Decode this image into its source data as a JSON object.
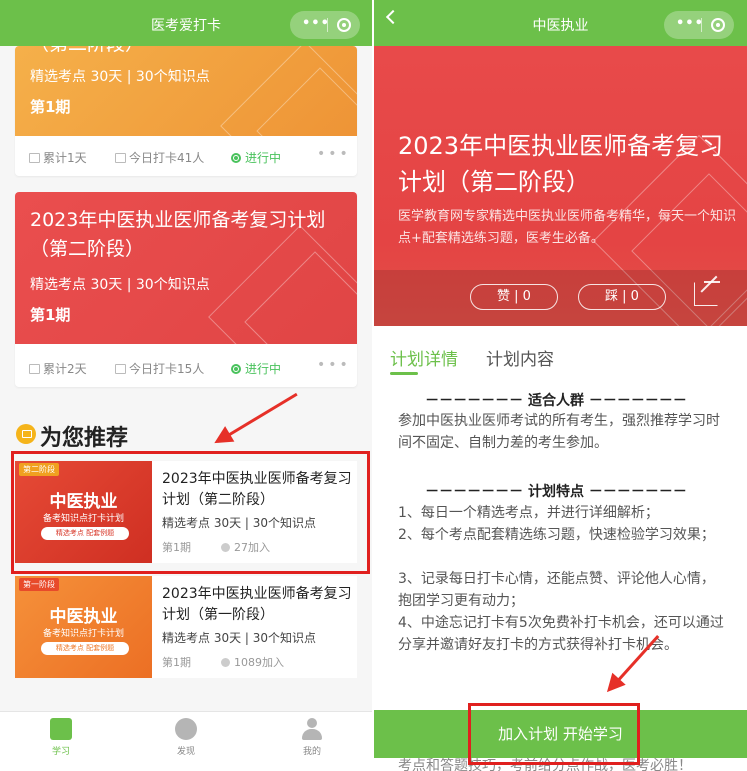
{
  "left": {
    "nav_title": "医考爱打卡",
    "cards": [
      {
        "title_partial": "（第二阶段）",
        "sub": "精选考点  30天 | 30个知识点",
        "period": "第1期",
        "stat_total": "累计1天",
        "stat_today": "今日打卡41人",
        "status": "进行中",
        "color": "#f2a03c"
      },
      {
        "title": "2023年中医执业医师备考复习计划（第二阶段）",
        "sub": "精选考点  30天 | 30个知识点",
        "period": "第1期",
        "stat_total": "累计2天",
        "stat_today": "今日打卡15人",
        "status": "进行中",
        "color": "#e85050"
      }
    ],
    "recommend_title": "为您推荐",
    "recommend": [
      {
        "tag": "第二阶段",
        "thumb_big": "中医执业",
        "thumb_small": "备考知识点打卡计划",
        "thumb_chips": "精选考点  配套例题",
        "title": "2023年中医执业医师备考复习计划（第二阶段）",
        "sub": "精选考点  30天 | 30个知识点",
        "period": "第1期",
        "joined": "27加入",
        "color": "#d8382a"
      },
      {
        "tag": "第一阶段",
        "thumb_big": "中医执业",
        "thumb_small": "备考知识点打卡计划",
        "thumb_chips": "精选考点  配套例题",
        "title": "2023年中医执业医师备考复习计划（第一阶段）",
        "sub": "精选考点  30天 | 30个知识点",
        "period": "第1期",
        "joined": "1089加入",
        "color": "#ef7a2a"
      }
    ],
    "tabbar": [
      {
        "label": "学习",
        "icon": "book-icon",
        "active": true
      },
      {
        "label": "发现",
        "icon": "compass-icon",
        "active": false
      },
      {
        "label": "我的",
        "icon": "user-icon",
        "active": false
      }
    ]
  },
  "right": {
    "nav_title": "中医执业",
    "hero_title": "2023年中医执业医师备考复习计划（第二阶段）",
    "hero_desc": "医学教育网专家精选中医执业医师备考精华，每天一个知识点+配套精选练习题，医考生必备。",
    "like": "赞 | 0",
    "dislike": "踩 | 0",
    "tabs": [
      "计划详情",
      "计划内容"
    ],
    "section1_title": "－－－－－－－  适合人群  －－－－－－－",
    "section1_text": "参加中医执业医师考试的所有考生，强烈推荐学习时间不固定、自制力差的考生参加。",
    "section2_title": "－－－－－－－  计划特点  －－－－－－－",
    "features": [
      "1、每日一个精选考点，并进行详细解析；",
      "2、每个考点配套精选练习题，快速检验学习效果；",
      "3、记录每日打卡心情，还能点赞、评论他人心情，抱团学习更有动力；",
      "4、中途忘记打卡有5次免费补打卡机会，还可以通过分享并邀请好友打卡的方式获得补打卡机会。"
    ],
    "cta": "加入计划 开始学习",
    "footer_peek": "考点和答题技巧，考前给分点作战，医考必胜！"
  },
  "colors": {
    "brand_green": "#6cc04a",
    "highlight_red": "#e0201e"
  }
}
